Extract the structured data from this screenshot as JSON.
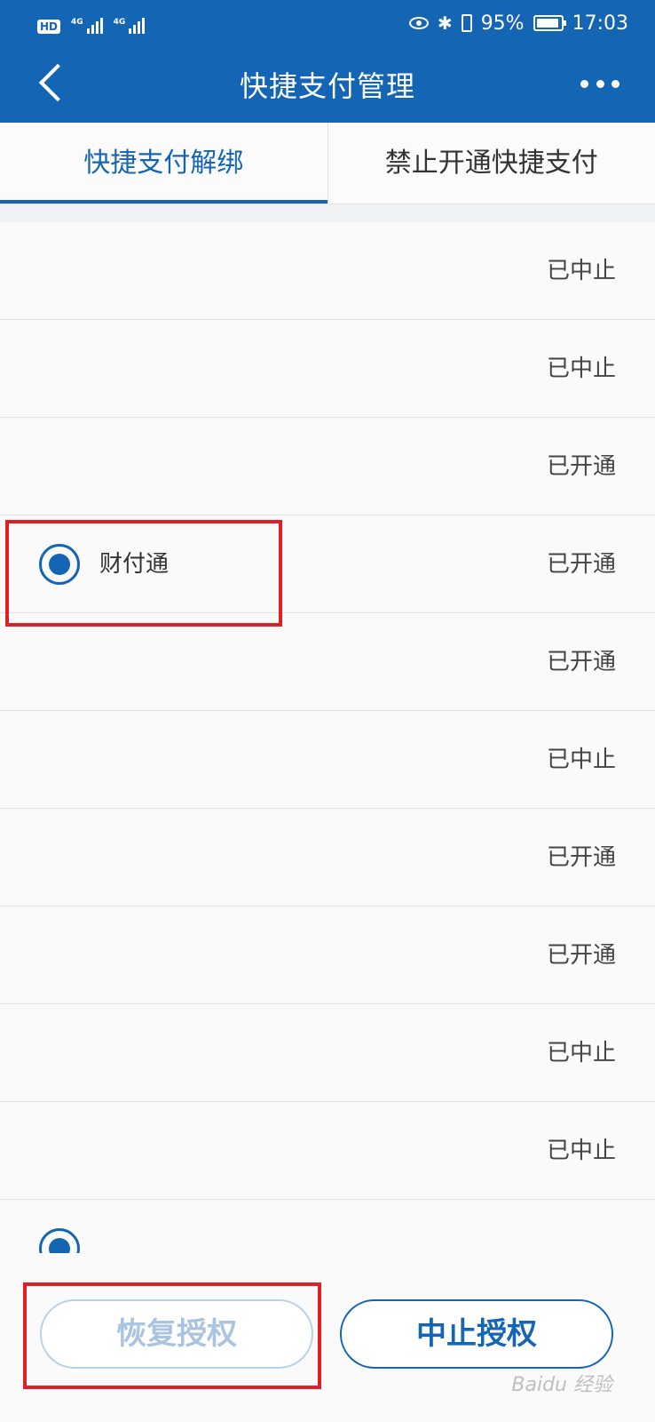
{
  "status_bar": {
    "left_badge": "HD",
    "signal_label": "4G",
    "battery": "95%",
    "time": "17:03"
  },
  "header": {
    "title": "快捷支付管理"
  },
  "tabs": [
    {
      "label": "快捷支付解绑",
      "active": true
    },
    {
      "label": "禁止开通快捷支付",
      "active": false
    }
  ],
  "list": {
    "rows": [
      {
        "name": "",
        "status": "已中止"
      },
      {
        "name": "",
        "status": "已中止"
      },
      {
        "name": "",
        "status": "已开通"
      },
      {
        "name": "财付通",
        "status": "已开通",
        "selected": true
      },
      {
        "name": "",
        "status": "已开通"
      },
      {
        "name": "",
        "status": "已中止"
      },
      {
        "name": "",
        "status": "已开通"
      },
      {
        "name": "",
        "status": "已开通"
      },
      {
        "name": "",
        "status": "已中止"
      },
      {
        "name": "",
        "status": "已中止"
      }
    ]
  },
  "buttons": {
    "restore": "恢复授权",
    "stop": "中止授权"
  },
  "watermark": "Baidu 经验",
  "colors": {
    "brand": "#1466b5",
    "highlight": "#e02027"
  }
}
